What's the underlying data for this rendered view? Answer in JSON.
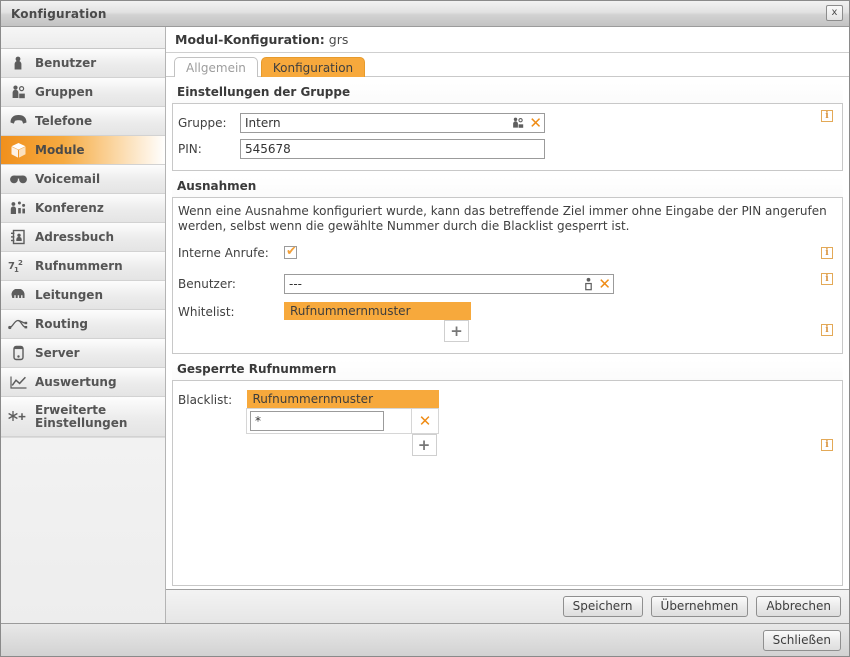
{
  "window": {
    "title": "Konfiguration",
    "close_label": "x"
  },
  "sidebar": {
    "items": [
      {
        "label": "Benutzer",
        "icon": "user-icon",
        "active": false
      },
      {
        "label": "Gruppen",
        "icon": "group-icon",
        "active": false
      },
      {
        "label": "Telefone",
        "icon": "phone-icon",
        "active": false
      },
      {
        "label": "Module",
        "icon": "module-cube-icon",
        "active": true
      },
      {
        "label": "Voicemail",
        "icon": "voicemail-icon",
        "active": false
      },
      {
        "label": "Konferenz",
        "icon": "conference-icon",
        "active": false
      },
      {
        "label": "Adressbuch",
        "icon": "addressbook-icon",
        "active": false
      },
      {
        "label": "Rufnummern",
        "icon": "numbers-icon",
        "active": false
      },
      {
        "label": "Leitungen",
        "icon": "lines-icon",
        "active": false
      },
      {
        "label": "Routing",
        "icon": "routing-icon",
        "active": false
      },
      {
        "label": "Server",
        "icon": "server-icon",
        "active": false
      },
      {
        "label": "Auswertung",
        "icon": "chart-icon",
        "active": false
      },
      {
        "label": "Erweiterte Einstellungen",
        "icon": "advanced-settings-icon",
        "active": false
      }
    ]
  },
  "content": {
    "module_head_label": "Modul-Konfiguration:",
    "module_head_value": "grs",
    "tabs": [
      {
        "label": "Allgemein",
        "active": false
      },
      {
        "label": "Konfiguration",
        "active": true
      }
    ],
    "section_group": {
      "title": "Einstellungen der Gruppe",
      "gruppe": {
        "label": "Gruppe:",
        "value": "Intern",
        "picker_icon": "group-picker-icon",
        "clear_icon": "clear-x-icon"
      },
      "pin": {
        "label": "PIN:",
        "value": "545678"
      },
      "info_icon": "info-icon"
    },
    "section_exceptions": {
      "title": "Ausnahmen",
      "help_text": "Wenn eine Ausnahme konfiguriert wurde, kann das betreffende Ziel immer ohne Eingabe der PIN angerufen werden, selbst wenn die gewählte Nummer durch die Blacklist gesperrt ist.",
      "internal_calls": {
        "label": "Interne Anrufe:",
        "checked": true,
        "tick": "✔"
      },
      "benutzer": {
        "label": "Benutzer:",
        "value": "---",
        "picker_icon": "user-picker-icon",
        "clear_icon": "clear-x-icon"
      },
      "whitelist": {
        "label": "Whitelist:",
        "column_header": "Rufnummernmuster",
        "rows": [],
        "add_label": "+"
      },
      "info_icon": "info-icon"
    },
    "section_blocked": {
      "title": "Gesperrte Rufnummern",
      "blacklist": {
        "label": "Blacklist:",
        "column_header": "Rufnummernmuster",
        "rows": [
          {
            "pattern": "*",
            "delete_label": "✕"
          }
        ],
        "add_label": "+"
      },
      "info_icon": "info-icon"
    }
  },
  "form_footer": {
    "save_label": "Speichern",
    "apply_label": "Übernehmen",
    "cancel_label": "Abbrechen"
  },
  "window_footer": {
    "close_label": "Schließen"
  },
  "colors": {
    "accent_orange": "#f7a93c",
    "accent_orange_dark": "#f0901c",
    "x_orange": "#ef8c16",
    "info_border": "#e3a957",
    "text": "#3c3c3c"
  }
}
